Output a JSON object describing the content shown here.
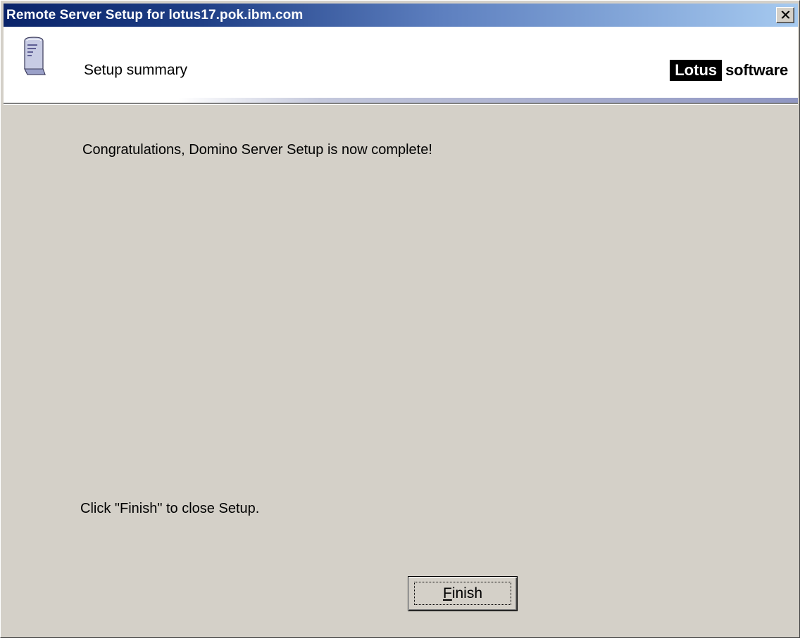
{
  "window": {
    "title": "Remote Server Setup for lotus17.pok.ibm.com",
    "close_icon": "close-x-icon"
  },
  "header": {
    "icon": "server-document-icon",
    "title": "Setup summary",
    "logo_brand": "Lotus",
    "logo_word": "software"
  },
  "body": {
    "message": "Congratulations, Domino Server Setup is now complete!",
    "instruction": "Click \"Finish\" to close Setup."
  },
  "buttons": {
    "finish_mnemonic": "F",
    "finish_rest": "inish"
  },
  "colors": {
    "titlebar_start": "#0a246a",
    "titlebar_end": "#a6caf0",
    "dialog_face": "#d4d0c8",
    "header_bg": "#ffffff"
  }
}
